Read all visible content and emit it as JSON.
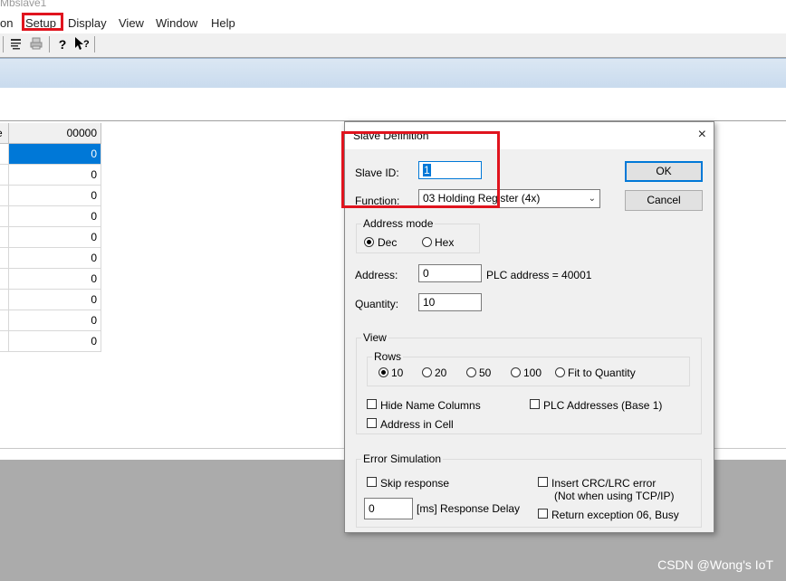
{
  "window": {
    "title": "Mbslave1"
  },
  "menu": {
    "items": [
      "on",
      "Setup",
      "Display",
      "View",
      "Window",
      "Help"
    ]
  },
  "toolbar": {
    "icons": [
      "list-icon",
      "print-icon",
      "help-icon",
      "whats-this-icon"
    ]
  },
  "grid": {
    "row_header_label": "e",
    "column_header": "00000",
    "values": [
      "0",
      "0",
      "0",
      "0",
      "0",
      "0",
      "0",
      "0",
      "0",
      "0"
    ]
  },
  "dialog": {
    "title": "Slave Definition",
    "close_glyph": "×",
    "slave_id_label": "Slave ID:",
    "slave_id_value": "1",
    "function_label": "Function:",
    "function_value": "03 Holding Register (4x)",
    "ok_label": "OK",
    "cancel_label": "Cancel",
    "address_mode": {
      "title": "Address mode",
      "dec": "Dec",
      "hex": "Hex",
      "selected": "Dec"
    },
    "address_label": "Address:",
    "address_value": "0",
    "plc_address_text": "PLC address = 40001",
    "quantity_label": "Quantity:",
    "quantity_value": "10",
    "view": {
      "title": "View",
      "rows_title": "Rows",
      "rows_options": [
        "10",
        "20",
        "50",
        "100",
        "Fit to Quantity"
      ],
      "rows_selected": "10",
      "hide_name_columns": "Hide Name Columns",
      "plc_addresses": "PLC Addresses (Base 1)",
      "address_in_cell": "Address in Cell"
    },
    "error_simulation": {
      "title": "Error Simulation",
      "skip_response": "Skip response",
      "insert_crc": "Insert CRC/LRC error",
      "insert_crc_note": "(Not when using TCP/IP)",
      "delay_value": "0",
      "delay_label": "[ms] Response Delay",
      "return_exception": "Return exception 06, Busy"
    }
  },
  "watermark": "CSDN @Wong's IoT",
  "colors": {
    "accent": "#0078d7",
    "highlight": "#e0141e",
    "band": "#c9dbee"
  }
}
